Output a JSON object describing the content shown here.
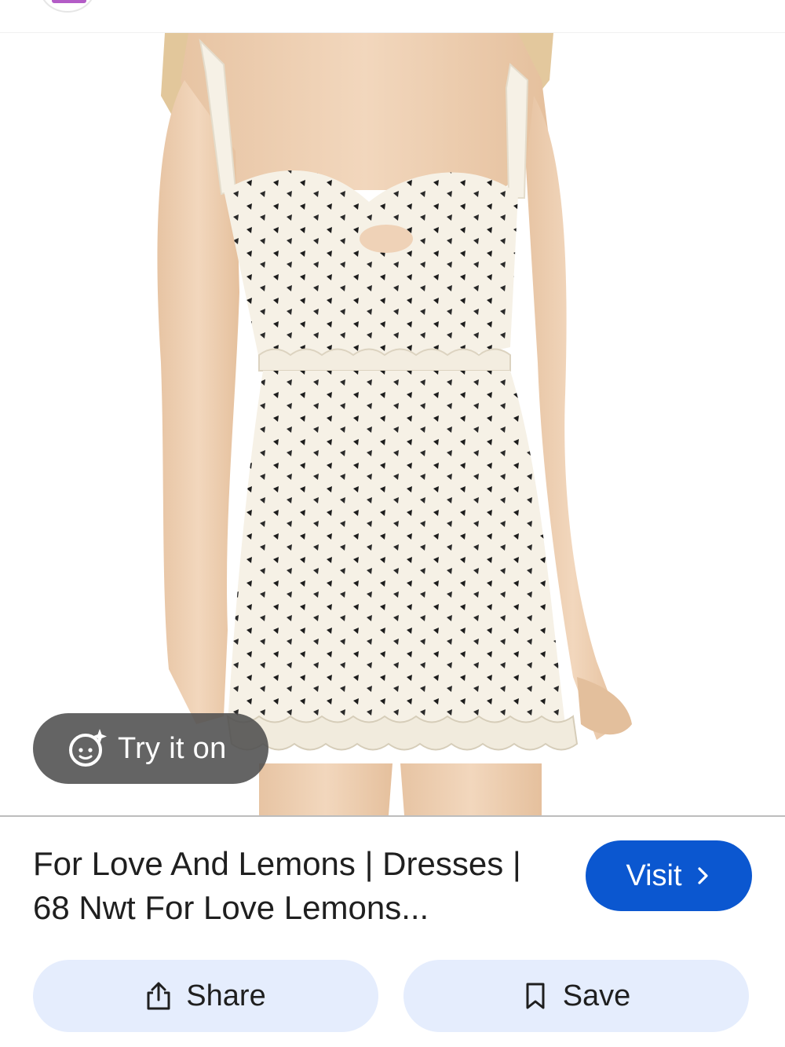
{
  "image": {
    "subject": "dress-photo"
  },
  "try_on": {
    "label": "Try it on",
    "icon": "sparkle-face-icon"
  },
  "result": {
    "title": "For Love And Lemons | Dresses | 68 Nwt For Love Lemons..."
  },
  "buttons": {
    "visit_label": "Visit",
    "visit_icon": "chevron-right-icon",
    "share_label": "Share",
    "share_icon": "share-icon",
    "save_label": "Save",
    "save_icon": "bookmark-icon"
  },
  "colors": {
    "accent": "#0b57d0",
    "chip_bg": "#e5edfd",
    "overlay": "#4e4e4e"
  }
}
